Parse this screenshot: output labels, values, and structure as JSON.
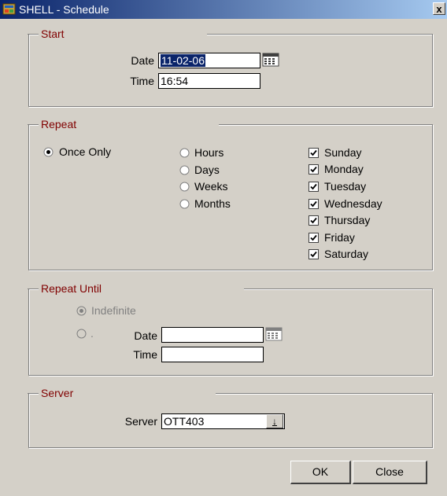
{
  "window": {
    "title": "SHELL - Schedule",
    "close_label": "x"
  },
  "start": {
    "group_label": "Start",
    "date_label": "Date",
    "date_value": "11-02-06",
    "time_label": "Time",
    "time_value": "16:54"
  },
  "repeat": {
    "group_label": "Repeat",
    "once_only_label": "Once Only",
    "once_only_selected": true,
    "intervals": [
      {
        "label": "Hours",
        "selected": false
      },
      {
        "label": "Days",
        "selected": false
      },
      {
        "label": "Weeks",
        "selected": false
      },
      {
        "label": "Months",
        "selected": false
      }
    ],
    "days": [
      {
        "label": "Sunday",
        "checked": true
      },
      {
        "label": "Monday",
        "checked": true
      },
      {
        "label": "Tuesday",
        "checked": true
      },
      {
        "label": "Wednesday",
        "checked": true
      },
      {
        "label": "Thursday",
        "checked": true
      },
      {
        "label": "Friday",
        "checked": true
      },
      {
        "label": "Saturday",
        "checked": true
      }
    ]
  },
  "repeat_until": {
    "group_label": "Repeat Until",
    "indefinite_label": "Indefinite",
    "indefinite_selected": true,
    "date_radio_label": ".",
    "date_label": "Date",
    "date_value": "",
    "time_label": "Time",
    "time_value": ""
  },
  "server": {
    "group_label": "Server",
    "server_label": "Server",
    "server_value": "OTT403",
    "dropdown_glyph": "↓"
  },
  "buttons": {
    "ok_label": "OK",
    "close_label": "Close"
  },
  "colors": {
    "dialog_bg": "#d4d0c8",
    "title_bar": "#0a246a",
    "group_label": "#800000",
    "selection": "#0a246a"
  }
}
